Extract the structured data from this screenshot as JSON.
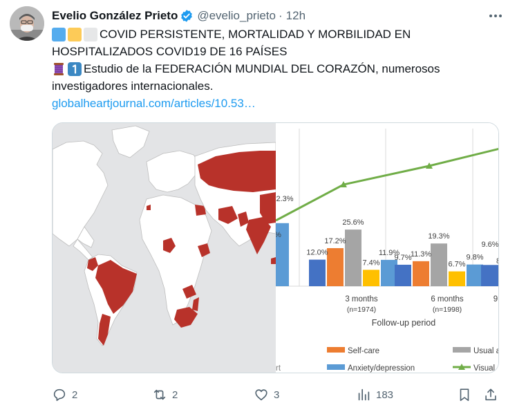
{
  "author": {
    "name": "Evelio González Prieto",
    "handle": "@evelio_prieto",
    "separator": "·",
    "time": "12h"
  },
  "tweet": {
    "line1": "COVID PERSISTENTE, MORTALIDAD Y MORBILIDAD EN",
    "line2": "HOSPITALIZADOS COVID19 DE 16 PAÍSES",
    "line3": "Estudio de la FEDERACIÓN MUNDIAL DEL CORAZÓN, numerosos",
    "line4": "investigadores internacionales.",
    "link": "globalheartjournal.com/articles/10.53…"
  },
  "colors": {
    "accent": "#1d9bf0",
    "highlight_country": "#b8322a",
    "series_blue_dark": "#4472c4",
    "series_orange": "#ed7d31",
    "series_gray": "#a5a5a5",
    "series_yellow": "#ffc000",
    "series_blue_light": "#5b9bd5",
    "series_green": "#70ad47"
  },
  "chart_data": {
    "type": "bar",
    "xlabel": "Follow-up period",
    "categories": [
      "3 months\n(n=1974)",
      "6 months\n(n=1998)"
    ],
    "series": [
      {
        "name": "",
        "values": [
          12.0,
          9.7
        ]
      },
      {
        "name": "Self-care",
        "values": [
          17.2,
          11.3
        ]
      },
      {
        "name": "Usual a",
        "values": [
          25.6,
          19.3
        ]
      },
      {
        "name": "",
        "values": [
          7.4,
          6.7
        ]
      },
      {
        "name": "Anxiety/depression",
        "values": [
          11.9,
          9.8
        ]
      }
    ],
    "line_series": {
      "name": "Visual",
      "type": "line"
    },
    "partial_labels": [
      "2.3%",
      "%",
      "9.6%",
      "8",
      "9",
      "rt"
    ],
    "legend_position": "bottom",
    "grid": "vertical"
  },
  "actions": {
    "replies": "2",
    "retweets": "2",
    "likes": "3",
    "views": "183"
  }
}
